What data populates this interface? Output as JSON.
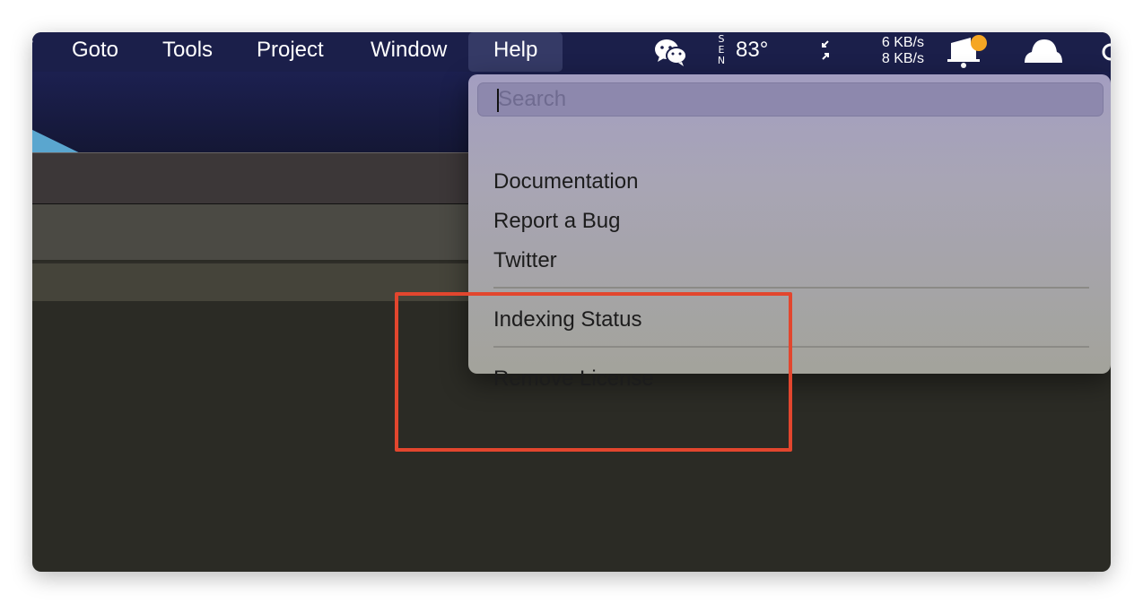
{
  "menubar": {
    "items": [
      {
        "label": "Goto"
      },
      {
        "label": "Tools"
      },
      {
        "label": "Project"
      },
      {
        "label": "Window"
      },
      {
        "label": "Help",
        "active": true
      }
    ],
    "tray": {
      "weather": {
        "compass_letters": [
          "S",
          "E",
          "N"
        ],
        "temperature": "83°"
      },
      "network": {
        "upload": "6 KB/s",
        "download": "8 KB/s"
      },
      "icons": [
        "wechat-icon",
        "compass-icon",
        "collapse-arrows-icon",
        "notification-bell-icon",
        "cloud-icon"
      ],
      "notification_badge_color": "#f5a623"
    },
    "background_color": "#1b1f4a",
    "active_item_color": "#353a66"
  },
  "help_menu": {
    "search": {
      "placeholder": "Search",
      "value": ""
    },
    "groups": [
      [
        "Documentation",
        "Report a Bug",
        "Twitter"
      ],
      [
        "Indexing Status"
      ],
      [
        "Remove License"
      ]
    ]
  },
  "annotation": {
    "color": "#e2462e"
  }
}
